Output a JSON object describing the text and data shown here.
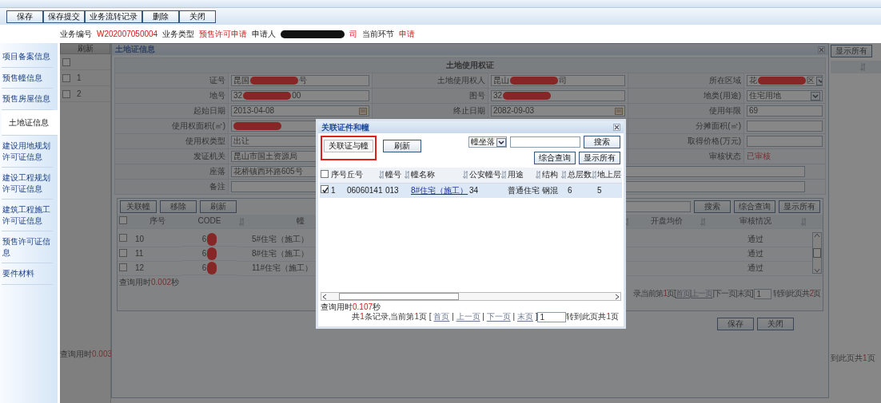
{
  "toolbar": {
    "buttons": [
      "保存",
      "保存提交",
      "业务流转记录",
      "删除",
      "关闭"
    ]
  },
  "info_bar": [
    {
      "label": "业务编号",
      "value": "W202007050004",
      "redacted": false
    },
    {
      "label": "业务类型",
      "value": "预售许可申请",
      "redacted": false
    },
    {
      "label": "申请人",
      "value": "司",
      "redacted": true
    },
    {
      "label": "当前环节",
      "value": "申请",
      "redacted": false
    }
  ],
  "sidebar": {
    "items": [
      {
        "label": "项目备案信息",
        "selected": false
      },
      {
        "label": "预售幢信息",
        "selected": false
      },
      {
        "label": "预售房屋信息",
        "selected": false
      },
      {
        "label": "土地证信息",
        "selected": true
      },
      {
        "label": "建设用地规划许可证信息",
        "selected": false
      },
      {
        "label": "建设工程规划许可证信息",
        "selected": false
      },
      {
        "label": "建筑工程施工许可证信息",
        "selected": false
      },
      {
        "label": "预售许可证信息",
        "selected": false
      },
      {
        "label": "要件材料",
        "selected": false
      }
    ]
  },
  "record_list": {
    "refresh_button": "刷新",
    "select_all_checked": false,
    "rows": [
      {
        "number": "1",
        "checked": false
      },
      {
        "number": "2",
        "checked": false
      }
    ],
    "query_time_label": "查询用时",
    "query_time": "0.003"
  },
  "land_dialog": {
    "title": "土地证信息",
    "form_heading": "土地使用权证",
    "rows": [
      {
        "left": {
          "label": "证号",
          "kind": "text",
          "value": "昆国",
          "redacted": true,
          "value_end": "号"
        },
        "middle": {
          "label": "土地使用权人",
          "kind": "text",
          "value": "昆山",
          "redacted": true,
          "value_end": "司"
        },
        "right": {
          "label": "所在区域",
          "kind": "select",
          "value": "花",
          "redacted": true,
          "value_end": "区"
        }
      },
      {
        "left": {
          "label": "地号",
          "kind": "text",
          "value": "32",
          "redacted": true,
          "value_end": "00"
        },
        "middle": {
          "label": "图号",
          "kind": "text",
          "value": "32",
          "redacted": true
        },
        "right": {
          "label": "地类(用途)",
          "kind": "select",
          "value": "住宅用地",
          "redacted": false
        }
      },
      {
        "left": {
          "label": "起始日期",
          "kind": "date",
          "value": "2013-04-08",
          "redacted": false
        },
        "middle": {
          "label": "终止日期",
          "kind": "date",
          "value": "2082-09-03",
          "redacted": false
        },
        "right": {
          "label": "使用年限",
          "kind": "text",
          "value": "69",
          "redacted": false
        }
      },
      {
        "left": {
          "label": "使用权面积(㎡)",
          "kind": "text",
          "redacted": true
        },
        "right": {
          "label": "分摊面积(㎡)",
          "kind": "text",
          "redacted": false
        }
      },
      {
        "left": {
          "label": "使用权类型",
          "kind": "text",
          "value": "出让",
          "redacted": false
        },
        "right": {
          "label": "取得价格(万元)",
          "kind": "text",
          "redacted": false
        }
      },
      {
        "left": {
          "label": "发证机关",
          "kind": "text",
          "value": "昆山市国土资源局",
          "redacted": false
        },
        "right": {
          "label": "审核状态",
          "kind": "status",
          "value": "已审核"
        }
      },
      {
        "wide": {
          "label": "座落",
          "kind": "text",
          "value": "花桥镇西环路605号",
          "redacted": false
        }
      },
      {
        "wide": {
          "label": "备注",
          "kind": "text",
          "redacted": false
        }
      }
    ],
    "grid": {
      "buttons": [
        "关联幢",
        "移除",
        "刷新"
      ],
      "search_buttons": [
        "搜索",
        "综合查询",
        "显示所有"
      ],
      "select_all_checked": false,
      "columns_left": [
        "序号",
        "CODE",
        "幢"
      ],
      "columns_right": [
        "开盘均价",
        "审核情况"
      ],
      "rows": [
        {
          "checked": false,
          "number": "10",
          "code": "6",
          "redacted": true,
          "name": "5#住宅（施工）",
          "status": "通过"
        },
        {
          "checked": false,
          "number": "11",
          "code": "6",
          "redacted": true,
          "name": "8#住宅（施工）",
          "status": "通过"
        },
        {
          "checked": false,
          "number": "12",
          "code": "6",
          "redacted": true,
          "name": "11#住宅（施工）",
          "status": "通过"
        }
      ],
      "query_time_label": "查询用时",
      "query_time": "0.002",
      "query_time_unit": "秒",
      "pager": [
        {
          "kind": "text",
          "text": "录,当前第"
        },
        {
          "kind": "number",
          "text": "1"
        },
        {
          "kind": "text",
          "text": "页["
        },
        {
          "kind": "link",
          "text": "首页",
          "disabled": true
        },
        {
          "kind": "text",
          "text": "|"
        },
        {
          "kind": "link",
          "text": "上一页",
          "disabled": true
        },
        {
          "kind": "text",
          "text": "|"
        },
        {
          "kind": "link",
          "text": "下一页",
          "disabled": false
        },
        {
          "kind": "text",
          "text": "|"
        },
        {
          "kind": "link",
          "text": "末页",
          "disabled": false
        },
        {
          "kind": "text",
          "text": "]"
        },
        {
          "kind": "input",
          "text": "1"
        },
        {
          "kind": "link",
          "text": "转到此页",
          "disabled": false
        },
        {
          "kind": "text",
          "text": "共"
        },
        {
          "kind": "number",
          "text": "2"
        },
        {
          "kind": "text",
          "text": "页"
        }
      ]
    },
    "actions": [
      "保存",
      "关闭"
    ]
  },
  "side_panel": {
    "button": "显示所有",
    "pager": [
      {
        "kind": "link",
        "text": "到此页",
        "disabled": false
      },
      {
        "kind": "text",
        "text": "共"
      },
      {
        "kind": "number",
        "text": "1"
      },
      {
        "kind": "text",
        "text": "页"
      }
    ]
  },
  "link_dialog": {
    "title": "关联证件和幢",
    "link_button": "关联证与幢",
    "link_button_highlighted": true,
    "refresh_button": "刷新",
    "search_select": "幢坐落",
    "search_buttons": [
      "搜索",
      "综合查询",
      "显示所有"
    ],
    "select_all_checked": false,
    "columns": [
      {
        "label": "序号",
        "sortable": false,
        "kind": "text"
      },
      {
        "label": "丘号",
        "sortable": true,
        "kind": "text"
      },
      {
        "label": "幢号",
        "sortable": true,
        "kind": "text"
      },
      {
        "label": "幢名称",
        "sortable": true,
        "kind": "link"
      },
      {
        "label": "公安幢号",
        "sortable": true,
        "kind": "text"
      },
      {
        "label": "用途",
        "sortable": true,
        "kind": "text"
      },
      {
        "label": "结构",
        "sortable": true,
        "kind": "text"
      },
      {
        "label": "总层数",
        "sortable": true,
        "kind": "text"
      },
      {
        "label": "地上层",
        "sortable": false,
        "kind": "text"
      }
    ],
    "rows": [
      {
        "selected": true,
        "checked": true,
        "cells": [
          "1",
          "06060141",
          "013",
          "8#住宅（施工）",
          "34",
          "普通住宅",
          "钢混",
          "6",
          "5"
        ]
      }
    ],
    "query_time_label": "查询用时",
    "query_time": "0.107",
    "query_time_unit": "秒",
    "pager": [
      {
        "kind": "text",
        "text": "共"
      },
      {
        "kind": "number",
        "text": "1"
      },
      {
        "kind": "text",
        "text": "条记录,当前第"
      },
      {
        "kind": "number",
        "text": "1"
      },
      {
        "kind": "text",
        "text": "页 [ "
      },
      {
        "kind": "link",
        "text": "首页",
        "disabled": true
      },
      {
        "kind": "text",
        "text": " | "
      },
      {
        "kind": "link",
        "text": "上一页",
        "disabled": true
      },
      {
        "kind": "text",
        "text": " | "
      },
      {
        "kind": "link",
        "text": "下一页",
        "disabled": true
      },
      {
        "kind": "text",
        "text": " | "
      },
      {
        "kind": "link",
        "text": "末页",
        "disabled": true
      },
      {
        "kind": "text",
        "text": " ]"
      },
      {
        "kind": "input",
        "text": "1"
      },
      {
        "kind": "link",
        "text": "转到此页",
        "disabled": false
      },
      {
        "kind": "text",
        "text": "共"
      },
      {
        "kind": "number",
        "text": "1"
      },
      {
        "kind": "text",
        "text": "页"
      }
    ]
  }
}
